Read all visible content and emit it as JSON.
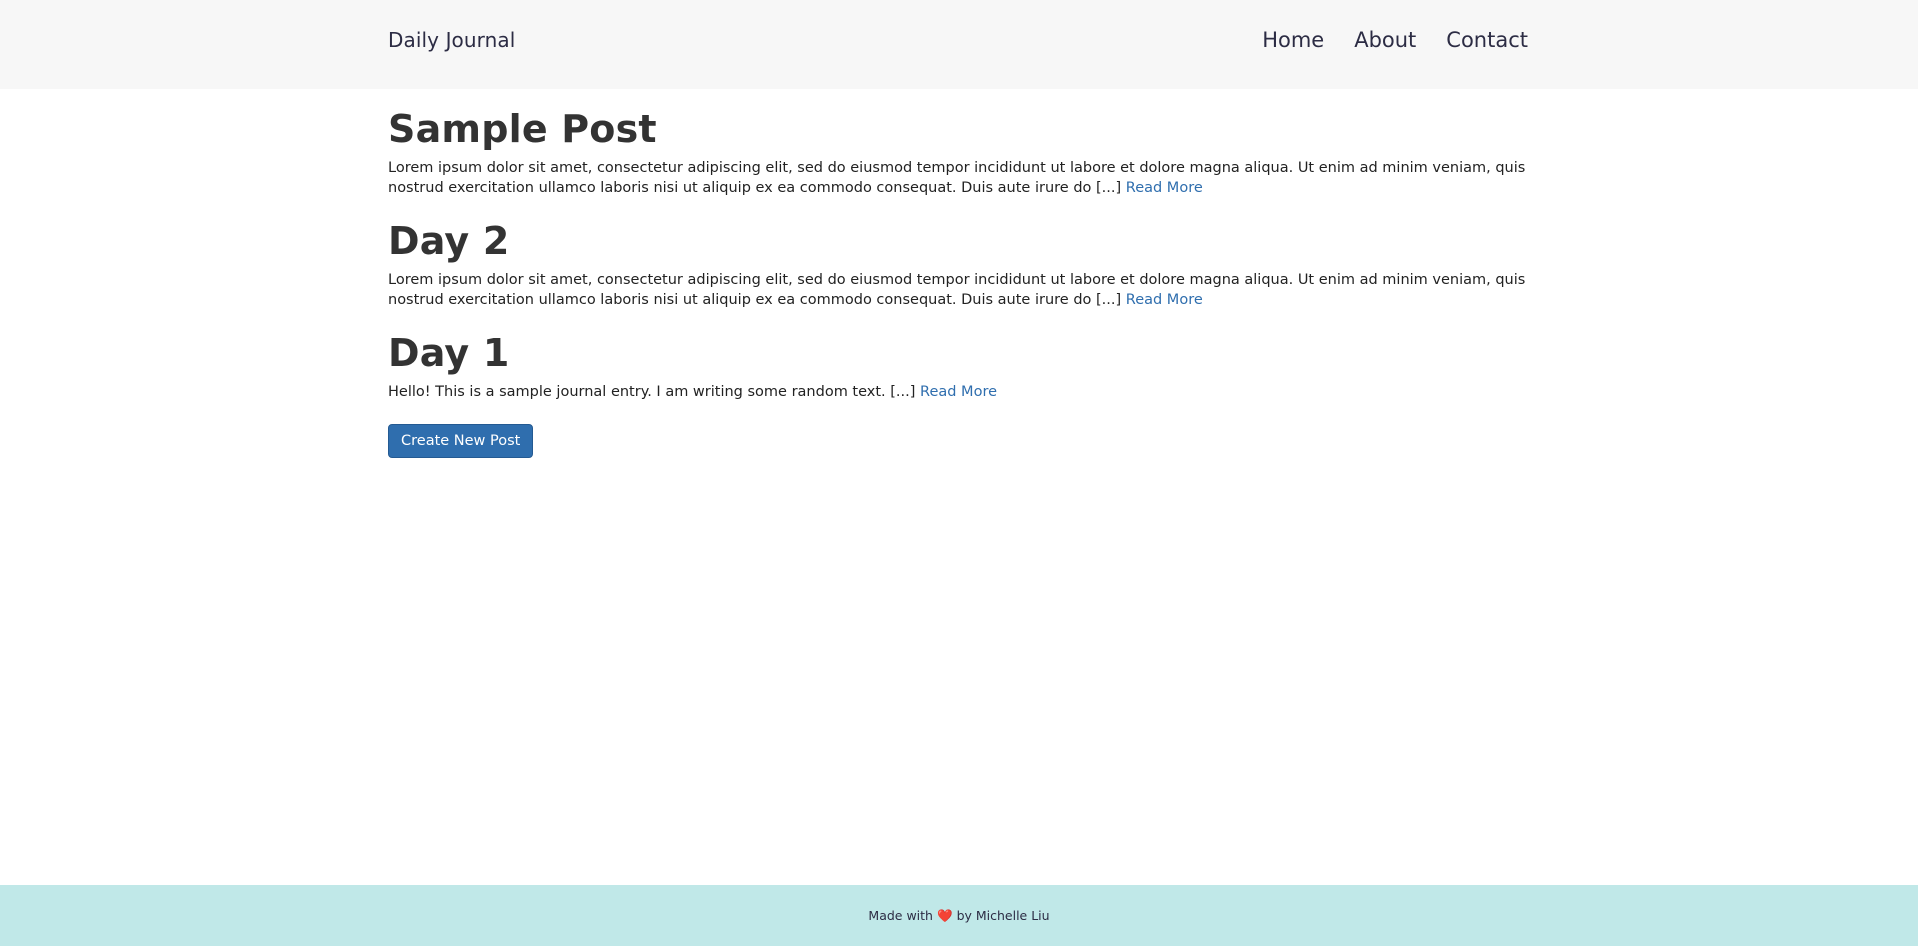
{
  "navbar": {
    "brand": "Daily Journal",
    "links": [
      "Home",
      "About",
      "Contact"
    ]
  },
  "posts": [
    {
      "title": "Sample Post",
      "excerpt": "Lorem ipsum dolor sit amet, consectetur adipiscing elit, sed do eiusmod tempor incididunt ut labore et dolore magna aliqua. Ut enim ad minim veniam, quis nostrud exercitation ullamco laboris nisi ut aliquip ex ea commodo consequat. Duis aute irure do [...]",
      "read_more": "Read More"
    },
    {
      "title": "Day 2",
      "excerpt": "Lorem ipsum dolor sit amet, consectetur adipiscing elit, sed do eiusmod tempor incididunt ut labore et dolore magna aliqua. Ut enim ad minim veniam, quis nostrud exercitation ullamco laboris nisi ut aliquip ex ea commodo consequat. Duis aute irure do [...]",
      "read_more": "Read More"
    },
    {
      "title": "Day 1",
      "excerpt": "Hello! This is a sample journal entry. I am writing some random text. [...]",
      "read_more": "Read More"
    }
  ],
  "create_button": "Create New Post",
  "footer": {
    "prefix": "Made with",
    "heart": "❤️",
    "suffix": "by Michelle Liu"
  },
  "colors": {
    "accent": "#2f6eae",
    "navbar_bg": "#f7f7f7",
    "footer_bg": "#c0e8e8"
  }
}
